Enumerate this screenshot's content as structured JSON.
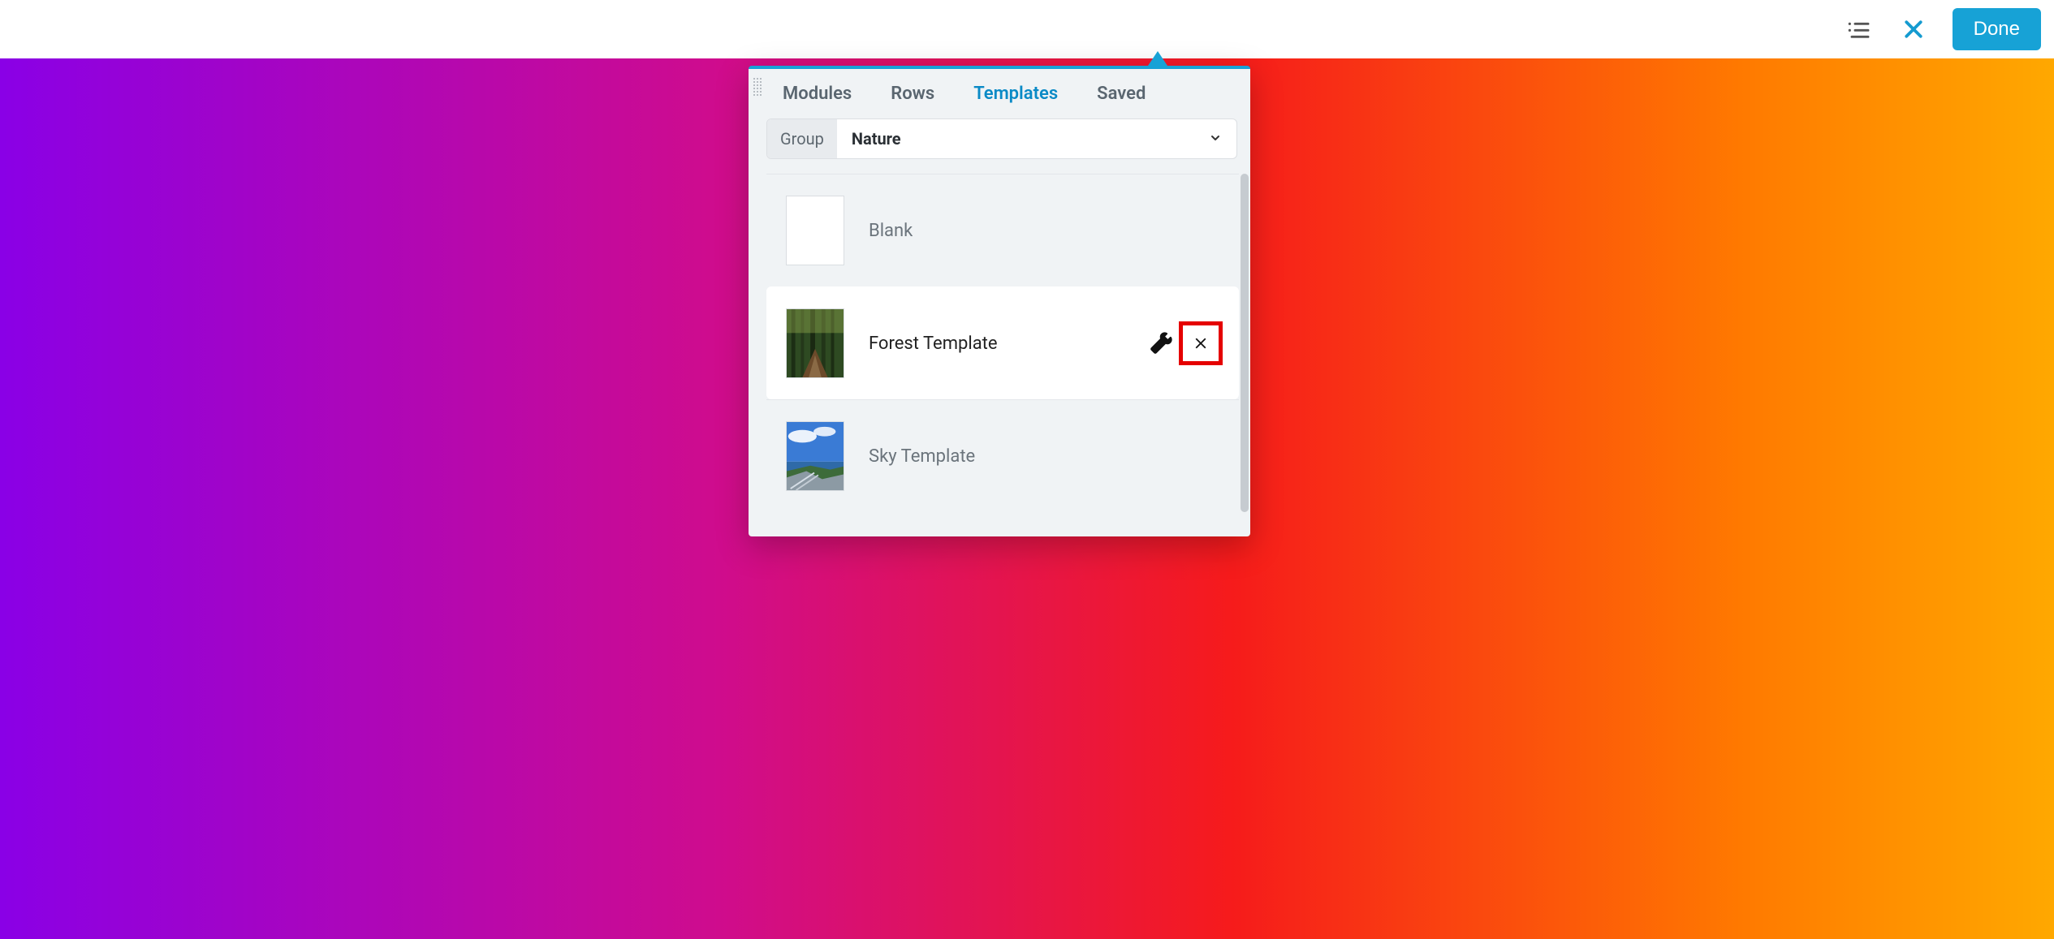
{
  "topbar": {
    "done_label": "Done"
  },
  "panel": {
    "tabs": {
      "modules": "Modules",
      "rows": "Rows",
      "templates": "Templates",
      "saved": "Saved",
      "active": "templates"
    },
    "group": {
      "label": "Group",
      "selected": "Nature"
    },
    "templates": [
      {
        "name": "Blank",
        "thumb": "blank",
        "active": false
      },
      {
        "name": "Forest Template",
        "thumb": "forest",
        "active": true
      },
      {
        "name": "Sky Template",
        "thumb": "sky",
        "active": false
      }
    ]
  }
}
